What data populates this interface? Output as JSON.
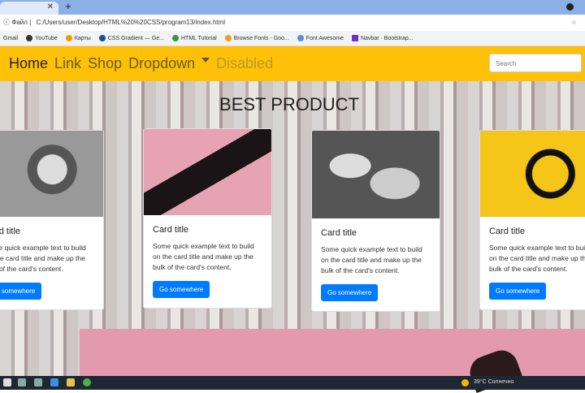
{
  "browser": {
    "new_tab": "+",
    "address": "C:/Users/user/Desktop/HTML%20%20CSS/program13/index.html",
    "address_prefix": "Файл",
    "bookmarks": [
      "Gmail",
      "YouTube",
      "Карты",
      "CSS Gradient — Ge...",
      "HTML Tutorial",
      "Browse Fonts - Goo...",
      "Font Awesome",
      "Navbar · Bootstrap..."
    ]
  },
  "navbar": {
    "items": [
      "Home",
      "Link",
      "Shop",
      "Dropdown",
      "Disabled"
    ],
    "search_placeholder": "Search"
  },
  "heading": "BEST PRODUCT",
  "cards": [
    {
      "title": "Card title",
      "text": "Some quick example text to build on the card title and make up the bulk of the card's content.",
      "button": "Go somewhere",
      "image": "watch"
    },
    {
      "title": "Card title",
      "text": "Some quick example text to build on the card title and make up the bulk of the card's content.",
      "button": "Go somewhere",
      "image": "sunglasses"
    },
    {
      "title": "Card title",
      "text": "Some quick example text to build on the card title and make up the bulk of the card's content.",
      "button": "Go somewhere",
      "image": "sneakers"
    },
    {
      "title": "Card title",
      "text": "Some quick example text to build on the card title and make up the bulk of the card's content.",
      "button": "Go somewhere",
      "image": "headphones"
    }
  ],
  "taskbar": {
    "temp": "39°C",
    "weather": "Солнечно"
  },
  "colors": {
    "navbar": "#ffc107",
    "button": "#007bff"
  }
}
